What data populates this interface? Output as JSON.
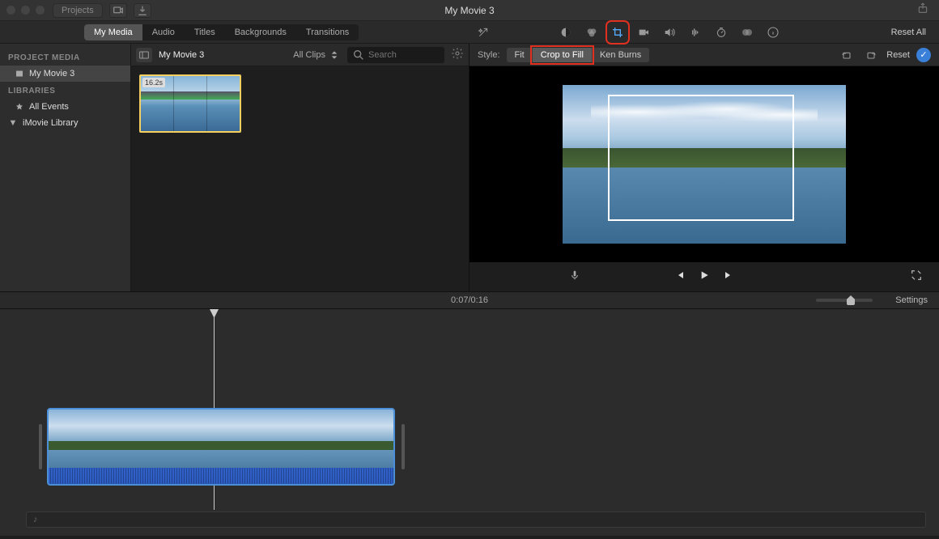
{
  "titlebar": {
    "title": "My Movie 3",
    "projects_btn": "Projects"
  },
  "tabs": {
    "my_media": "My Media",
    "audio": "Audio",
    "titles": "Titles",
    "backgrounds": "Backgrounds",
    "transitions": "Transitions"
  },
  "toolbar_right": {
    "reset_all": "Reset All"
  },
  "sidebar": {
    "project_media_heading": "PROJECT MEDIA",
    "project_name": "My Movie 3",
    "libraries_heading": "LIBRARIES",
    "all_events": "All Events",
    "imovie_library": "iMovie Library"
  },
  "browser": {
    "project": "My Movie 3",
    "all_clips": "All Clips",
    "search_placeholder": "Search",
    "clip_duration": "16.2s"
  },
  "viewer": {
    "style_label": "Style:",
    "fit": "Fit",
    "crop_to_fill": "Crop to Fill",
    "ken_burns": "Ken Burns",
    "reset": "Reset"
  },
  "time": {
    "current": "0:07",
    "sep": " / ",
    "total": "0:16",
    "settings": "Settings"
  }
}
